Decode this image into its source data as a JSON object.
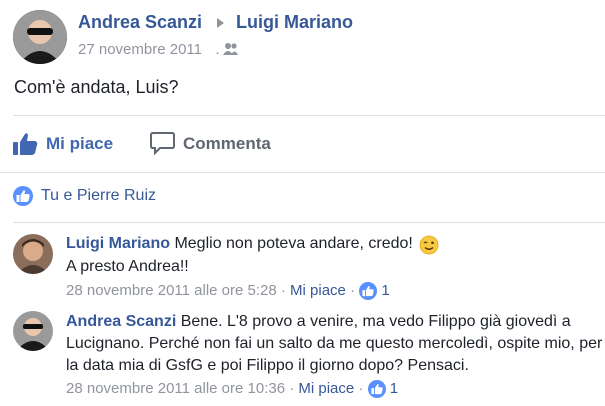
{
  "post": {
    "author": "Andrea Scanzi",
    "recipient": "Luigi Mariano",
    "date": "27 novembre 2011",
    "text": "Com'è andata, Luis?"
  },
  "actions": {
    "like_label": "Mi piace",
    "comment_label": "Commenta"
  },
  "likes_summary": "Tu e Pierre Ruiz",
  "comments": [
    {
      "author": "Luigi Mariano",
      "line1": "Meglio non poteva andare, credo!",
      "line2": "A presto Andrea!!",
      "timestamp": "28 novembre 2011 alle ore 5:28",
      "like_label": "Mi piace",
      "like_count": "1"
    },
    {
      "author": "Andrea Scanzi",
      "line1": "Bene. L'8 provo a venire, ma vedo Filippo già giovedì a",
      "line2": "Lucignano. Perché non fai un salto da me questo mercoledì, ospite mio, per",
      "line3": "la data mia di GsfG e poi Filippo il giorno dopo? Pensaci.",
      "timestamp": "28 novembre 2011 alle ore 10:36",
      "like_label": "Mi piace",
      "like_count": "1"
    }
  ],
  "colors": {
    "link": "#365899",
    "gray": "#90949c",
    "like_blue": "#5890ff",
    "divider": "#dddfe2"
  }
}
